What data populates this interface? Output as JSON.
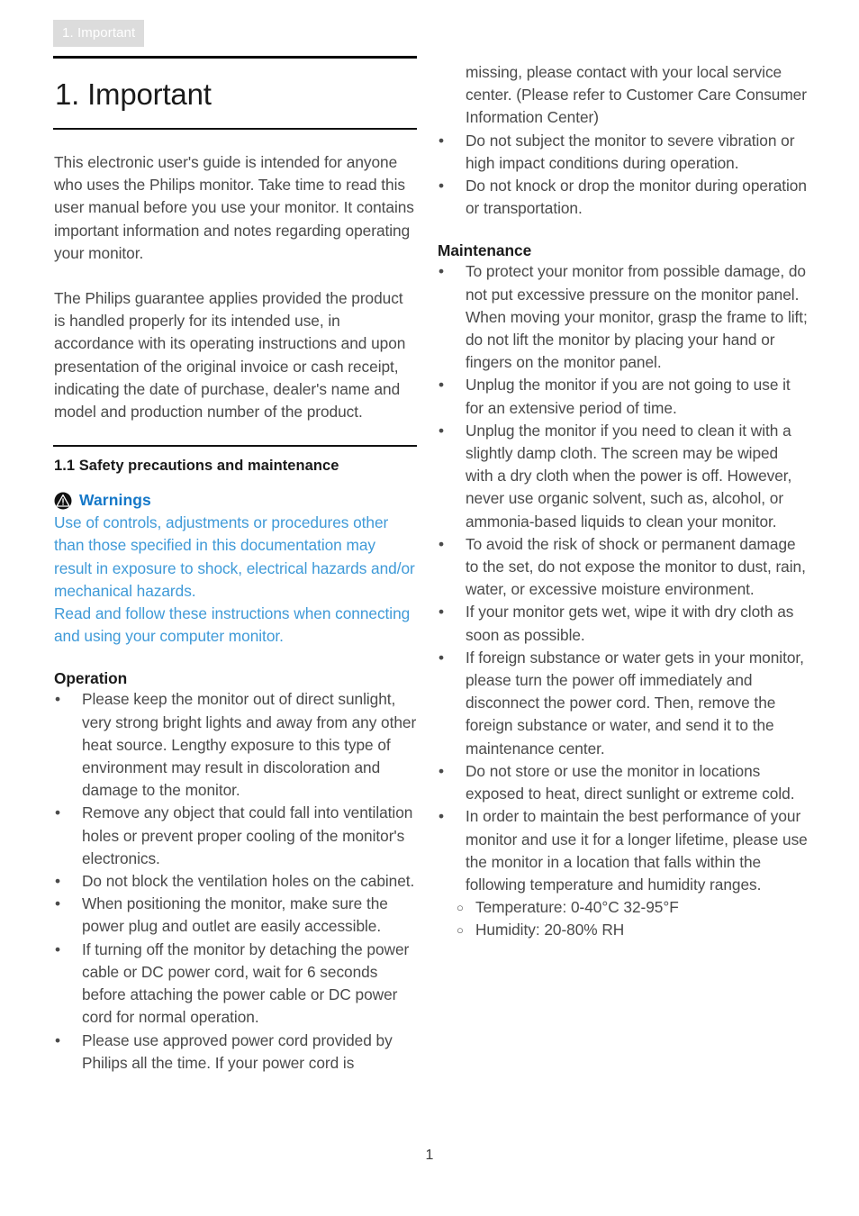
{
  "header": {
    "running_tag": "1. Important"
  },
  "chapter": {
    "title": "1. Important"
  },
  "left_column": {
    "intro_paragraph_1": "This electronic user's guide is intended for anyone who uses the Philips monitor. Take time to read this user manual before you use your monitor. It contains important information and notes regarding operating your monitor.",
    "intro_paragraph_2": "The Philips guarantee applies provided the product is handled properly for its intended use, in accordance with its operating instructions and upon presentation of the original invoice or cash receipt, indicating the date of purchase, dealer's name and model and production number of the product.",
    "section_title": "1.1 Safety precautions and maintenance",
    "warning": {
      "icon": "warning-triangle-icon",
      "title": "Warnings",
      "paragraph_1": "Use of controls, adjustments or procedures other than those specified in this documentation may result in exposure to shock, electrical hazards and/or mechanical hazards.",
      "paragraph_2": "Read and follow these instructions when connecting and using your computer monitor."
    },
    "operation": {
      "heading": "Operation",
      "bullets": [
        "Please keep the monitor out of direct sunlight, very strong bright lights and away from any other heat source. Lengthy exposure to this type of environment may result in discoloration and damage to the monitor.",
        "Remove any object that could fall into ventilation holes or prevent proper cooling of the monitor's electronics.",
        "Do not block the ventilation holes on the cabinet.",
        "When positioning the monitor, make sure the power plug and outlet are easily accessible.",
        "If turning off the monitor by detaching the power cable or DC power cord, wait for 6 seconds before attaching the power cable or DC power cord for normal operation.",
        "Please use approved power cord provided by Philips all the time. If your power cord is"
      ]
    }
  },
  "right_column": {
    "continued_bullet": "missing, please contact with your local service center. (Please refer to Customer Care Consumer Information Center)",
    "operation_bullets_continued": [
      "Do not subject the monitor to severe vibration or high impact conditions during operation.",
      "Do not knock or drop the monitor during operation or transportation."
    ],
    "maintenance": {
      "heading": "Maintenance",
      "bullets": [
        "To protect your monitor from possible damage, do not put excessive pressure on the monitor panel. When moving your monitor, grasp the frame to lift; do not lift the monitor by placing your hand or fingers on the monitor panel.",
        "Unplug the monitor if you are not going to use it for an extensive period of time.",
        "Unplug the monitor if you need to clean it with a slightly damp cloth. The screen may be wiped with a dry cloth when the power is off. However, never use organic solvent, such as, alcohol, or ammonia-based liquids to clean your monitor.",
        "To avoid the risk of shock or permanent damage to the set, do not expose the monitor to dust, rain, water, or excessive moisture environment.",
        "If your monitor gets wet, wipe it with dry cloth as soon as possible.",
        "If foreign substance or water gets in your monitor, please turn the power off immediately and disconnect the power cord. Then, remove the foreign substance or water, and send it to the maintenance center.",
        "Do not store or use the monitor in locations exposed to heat, direct sunlight or extreme cold.",
        "In order to maintain the best performance of your monitor and use it for a longer lifetime, please use the monitor in a location that falls within the following temperature and humidity ranges."
      ],
      "sub_bullets": [
        "Temperature: 0-40°C 32-95°F",
        "Humidity: 20-80% RH"
      ]
    }
  },
  "footer": {
    "page_number": "1"
  },
  "colors": {
    "tag_background": "#dcdcdc",
    "tag_text": "#ffffff",
    "warning_title": "#1578c8",
    "warning_body": "#3f9ad8",
    "body_text": "#4a4a4a",
    "rule": "#000000"
  },
  "glyphs": {
    "bullet": "•",
    "sub_bullet": "○"
  }
}
